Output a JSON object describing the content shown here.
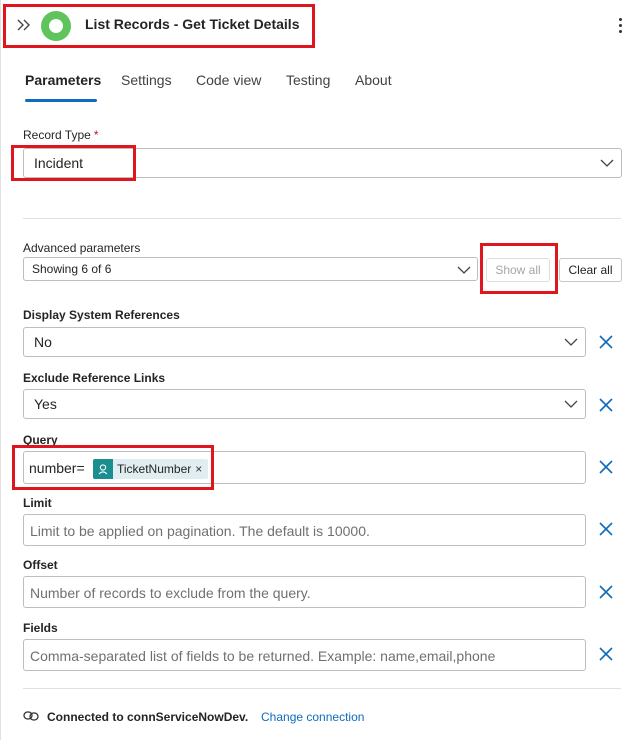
{
  "header": {
    "title": "List Records - Get Ticket Details",
    "expand_icon": "chevron-double-right-icon",
    "app_icon_color": "#5ec45b",
    "more_icon": "more-vertical-icon"
  },
  "tabs": [
    {
      "label": "Parameters",
      "active": true
    },
    {
      "label": "Settings",
      "active": false
    },
    {
      "label": "Code view",
      "active": false
    },
    {
      "label": "Testing",
      "active": false
    },
    {
      "label": "About",
      "active": false
    }
  ],
  "record_type": {
    "label": "Record Type",
    "required_mark": "*",
    "value": "Incident"
  },
  "advanced": {
    "label": "Advanced parameters",
    "value": "Showing 6 of 6",
    "show_all": "Show all",
    "clear_all": "Clear all"
  },
  "params": {
    "display_sys_refs": {
      "label": "Display System References",
      "value": "No"
    },
    "exclude_ref_links": {
      "label": "Exclude Reference Links",
      "value": "Yes"
    },
    "query": {
      "label": "Query",
      "prefix": "number=",
      "token": "TicketNumber",
      "token_remove": "×"
    },
    "limit": {
      "label": "Limit",
      "placeholder": "Limit to be applied on pagination. The default is 10000."
    },
    "offset": {
      "label": "Offset",
      "placeholder": "Number of records to exclude from the query."
    },
    "fields": {
      "label": "Fields",
      "placeholder": "Comma-separated list of fields to be returned. Example: name,email,phone"
    }
  },
  "connection": {
    "text": "Connected to connServiceNowDev.",
    "link": "Change connection"
  },
  "colors": {
    "accent": "#0f6cbd",
    "highlight_box": "#e0161e",
    "token_bg": "#1b8f8f"
  }
}
